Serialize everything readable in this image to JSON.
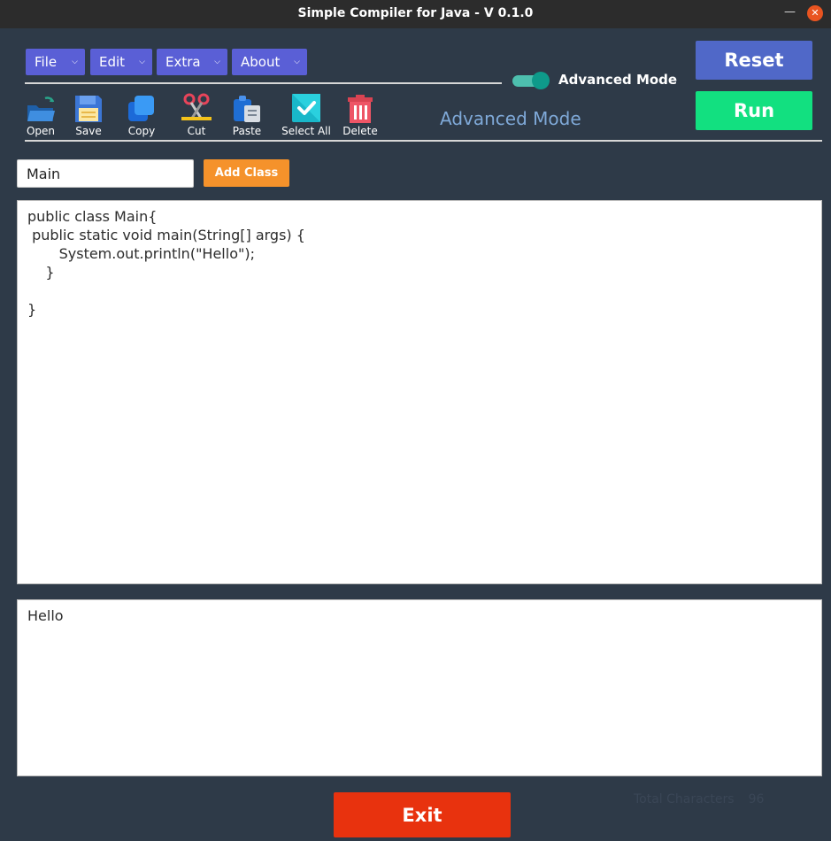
{
  "window": {
    "title": "Simple Compiler for Java - V 0.1.0",
    "minimize": "—",
    "close": "✕"
  },
  "menus": [
    {
      "label": "File"
    },
    {
      "label": "Edit"
    },
    {
      "label": "Extra"
    },
    {
      "label": "About"
    }
  ],
  "toolbar": {
    "open": "Open",
    "save": "Save",
    "copy": "Copy",
    "cut": "Cut",
    "paste": "Paste",
    "select_all": "Select All",
    "delete": "Delete"
  },
  "mode_toggle": {
    "label": "Advanced Mode",
    "on": true
  },
  "mode_text": "Advanced Mode",
  "buttons": {
    "reset": "Reset",
    "run": "Run",
    "add_class": "Add Class",
    "exit": "Exit"
  },
  "class_name": {
    "value": "Main"
  },
  "editor": {
    "code": "public class Main{\n public static void main(String[] args) {\n       System.out.println(\"Hello\");\n    }\n\n}"
  },
  "output": {
    "text": "Hello"
  },
  "status": {
    "label": "Total Characters",
    "count": "96"
  },
  "colors": {
    "accent": "#5a5fd6",
    "reset": "#5068c8",
    "run": "#12e080",
    "exit": "#e8320e",
    "add_class": "#f5922b",
    "toggle": "#0e9a8a"
  }
}
